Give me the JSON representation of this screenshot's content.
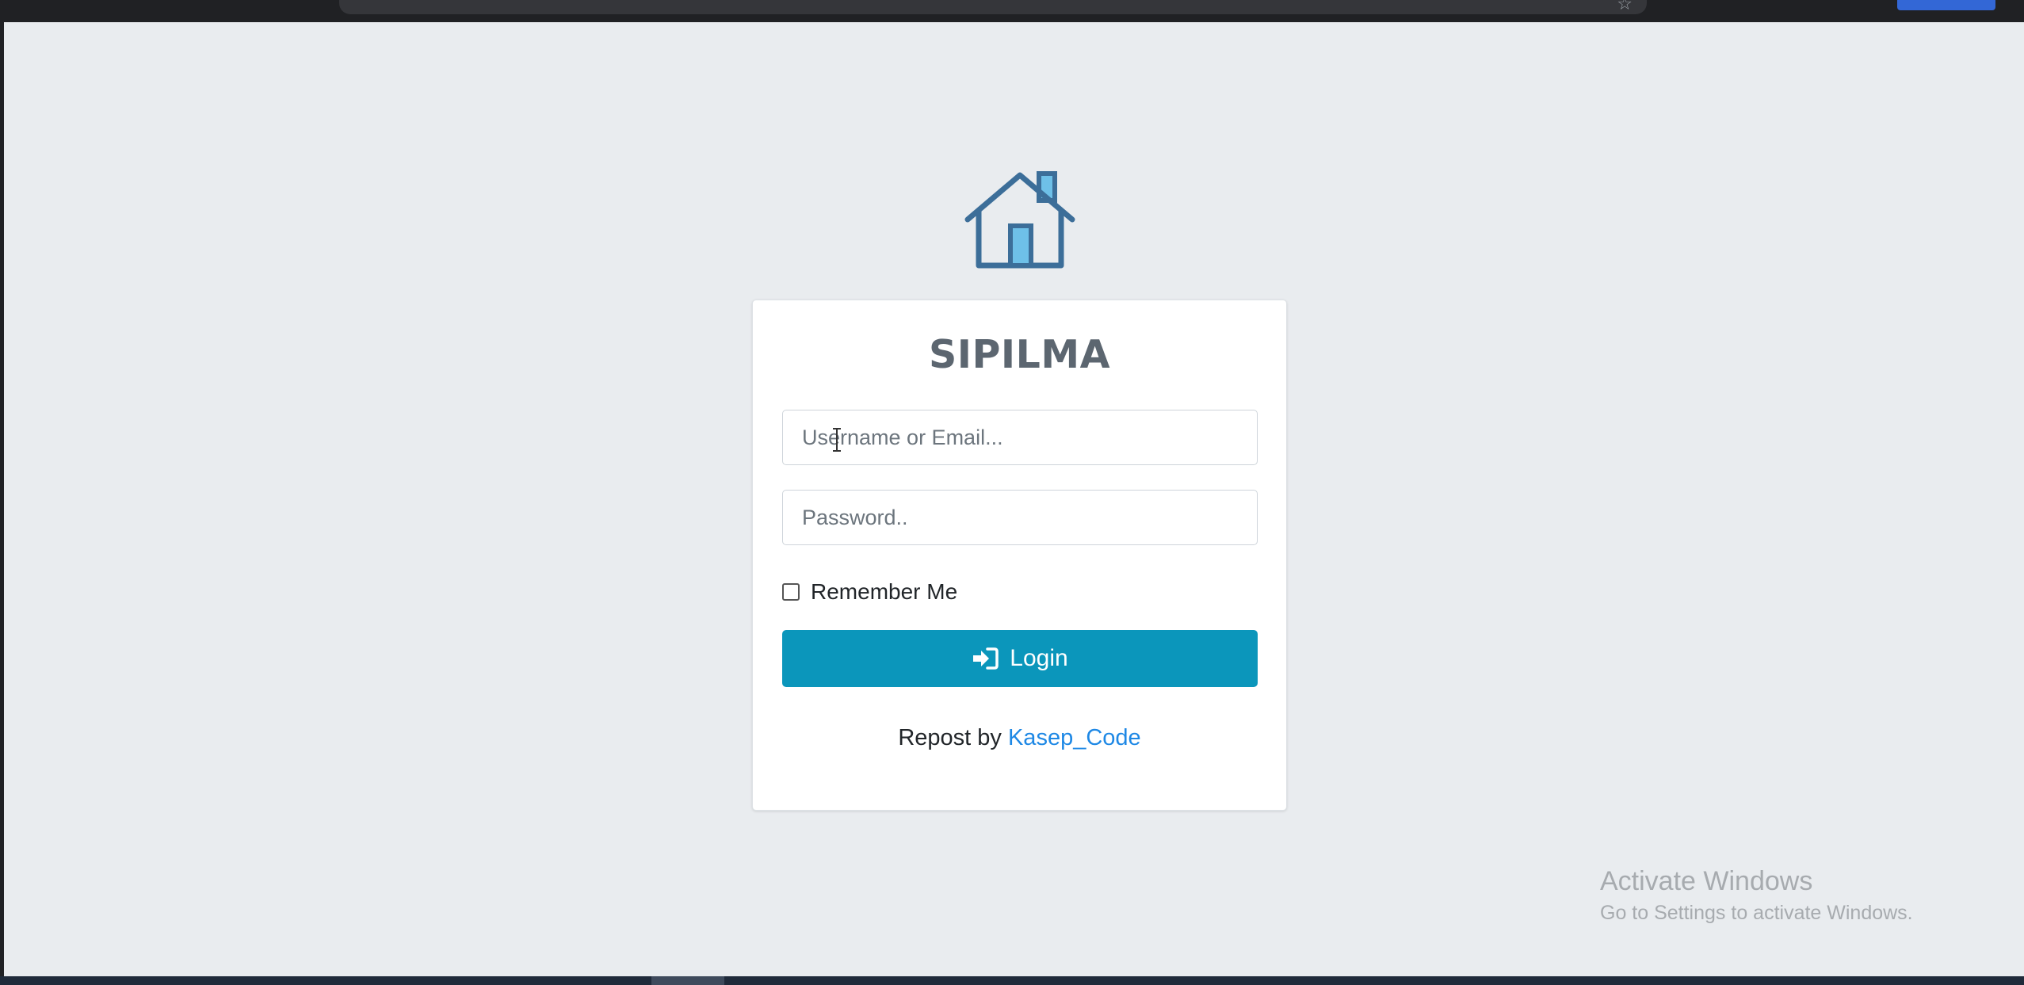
{
  "app": {
    "title": "SIPILMA"
  },
  "login_form": {
    "username_placeholder": "Username or Email...",
    "password_placeholder": "Password..",
    "remember_label": "Remember Me",
    "login_label": "Login"
  },
  "footer": {
    "prefix": "Repost by",
    "link_text": "Kasep_Code"
  },
  "watermark": {
    "title": "Activate Windows",
    "subtitle": "Go to Settings to activate Windows."
  },
  "colors": {
    "background": "#e9ecef",
    "primary_button": "#0b96bb",
    "link": "#1e88e5",
    "logo_stroke": "#3c6e99",
    "logo_accent": "#6ec0e8"
  },
  "icons": {
    "logo": "house-icon",
    "login": "sign-in-icon"
  }
}
